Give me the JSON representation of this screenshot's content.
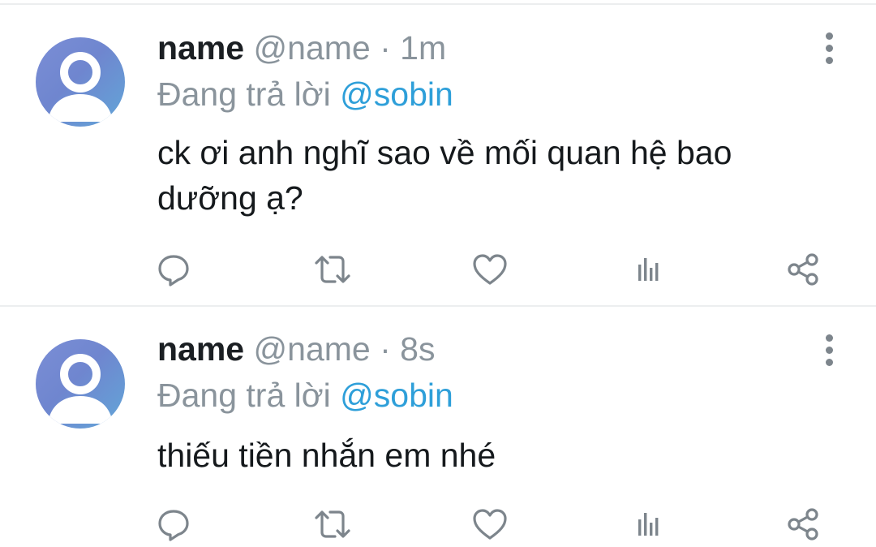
{
  "tweets": [
    {
      "display_name": "name",
      "handle": "@name",
      "separator": "·",
      "time": "1m",
      "reply_prefix": "Đang trả lời",
      "reply_to": "@sobin",
      "text": "ck ơi anh nghĩ sao về mối quan hệ bao dưỡng ạ?"
    },
    {
      "display_name": "name",
      "handle": "@name",
      "separator": "·",
      "time": "8s",
      "reply_prefix": "Đang trả lời",
      "reply_to": "@sobin",
      "text": "thiếu tiền nhắn em nhé"
    }
  ],
  "icons": {
    "avatar": "default-avatar-icon",
    "more": "more-vertical-icon",
    "reply": "reply-icon",
    "retweet": "retweet-icon",
    "like": "heart-icon",
    "analytics": "analytics-icon",
    "share": "share-icon"
  },
  "colors": {
    "mention": "#2e9fd9",
    "secondary_text": "#8a949c",
    "icon": "#7d858c",
    "divider": "#eceeef"
  }
}
